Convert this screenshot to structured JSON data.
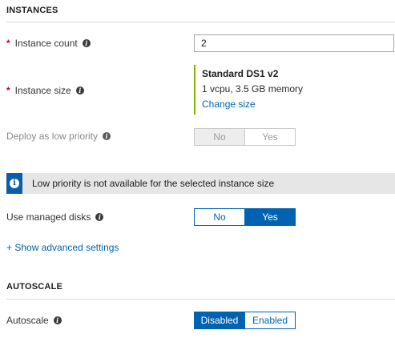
{
  "instances": {
    "section_title": "INSTANCES",
    "count_label": "Instance count",
    "count_value": "2",
    "size_label": "Instance size",
    "size_name": "Standard DS1 v2",
    "size_spec": "1 vcpu, 3.5 GB memory",
    "size_change_link": "Change size",
    "low_priority_label": "Deploy as low priority",
    "low_priority_options": [
      "No",
      "Yes"
    ],
    "low_priority_selected": "No",
    "banner_text": "Low priority is not available for the selected instance size",
    "managed_disks_label": "Use managed disks",
    "managed_disks_options": [
      "No",
      "Yes"
    ],
    "managed_disks_selected": "Yes",
    "advanced_link": "+ Show advanced settings"
  },
  "autoscale": {
    "section_title": "AUTOSCALE",
    "label": "Autoscale",
    "options": [
      "Disabled",
      "Enabled"
    ],
    "selected": "Disabled"
  },
  "icons": {
    "required_marker": "*",
    "info": "i"
  },
  "colors": {
    "accent": "#0063b1",
    "required": "#c8002a",
    "size_border": "#7fba00",
    "banner_icon": "#0a5ea8"
  }
}
